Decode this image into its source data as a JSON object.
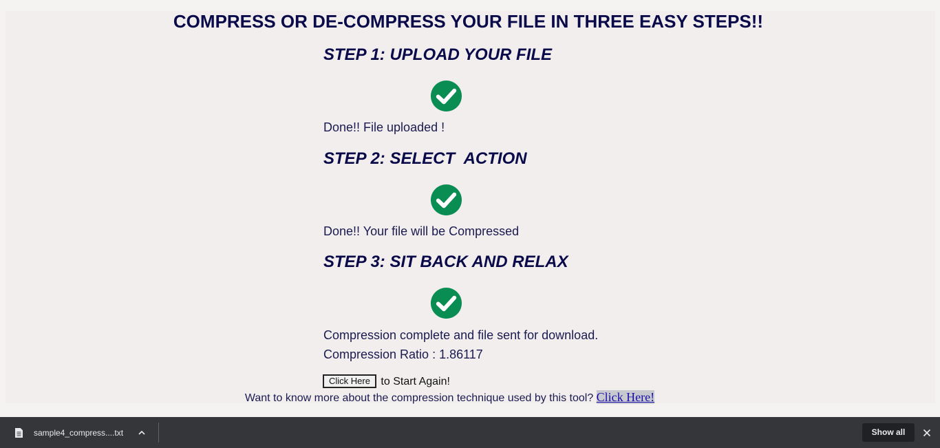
{
  "page": {
    "title": "COMPRESS OR DE-COMPRESS YOUR FILE IN THREE EASY STEPS!!",
    "steps": [
      {
        "title": "STEP 1: UPLOAD YOUR FILE",
        "status_icon": "checkmark-circle-icon",
        "messages": [
          "Done!! File uploaded !"
        ]
      },
      {
        "title": "STEP 2: SELECT  ACTION",
        "status_icon": "checkmark-circle-icon",
        "messages": [
          "Done!! Your file will be Compressed"
        ]
      },
      {
        "title": "STEP 3: SIT BACK AND RELAX",
        "status_icon": "checkmark-circle-icon",
        "messages": [
          "Compression complete and file sent for download.",
          "Compression Ratio : 1.86117"
        ]
      }
    ],
    "restart": {
      "button_label": "Click Here",
      "suffix": "to Start Again!"
    },
    "more_info": {
      "text": "Want to know more about the compression technique used by this tool?",
      "link_label": "Click Here!"
    }
  },
  "download_bar": {
    "file_name": "sample4_compress....txt",
    "file_icon": "document-icon",
    "show_all_label": "Show all",
    "close_icon": "close-icon"
  },
  "colors": {
    "heading": "#0a0a4a",
    "check_green": "#0a8d52",
    "page_background": "#f1eeed",
    "download_bar": "#35363a",
    "link": "#1a0dab"
  }
}
